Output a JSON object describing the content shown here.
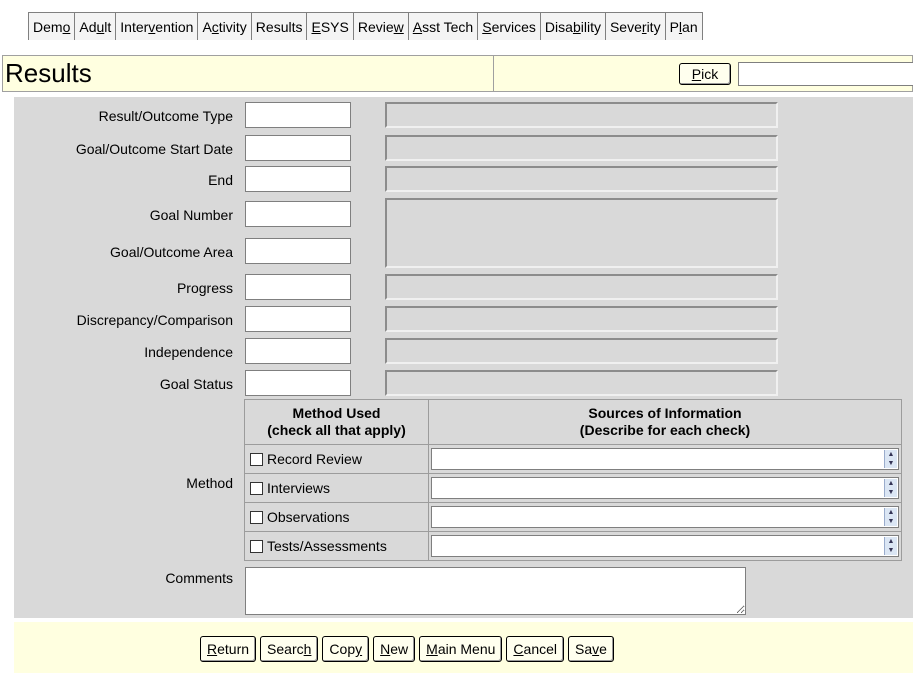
{
  "tabs": [
    {
      "pre": "Dem",
      "key": "o",
      "post": ""
    },
    {
      "pre": "Ad",
      "key": "u",
      "post": "lt"
    },
    {
      "pre": "Inter",
      "key": "v",
      "post": "ention"
    },
    {
      "pre": "A",
      "key": "c",
      "post": "tivity"
    },
    {
      "pre": "Results",
      "key": "",
      "post": ""
    },
    {
      "pre": "",
      "key": "E",
      "post": "SYS"
    },
    {
      "pre": "Revie",
      "key": "w",
      "post": ""
    },
    {
      "pre": "",
      "key": "A",
      "post": "sst Tech"
    },
    {
      "pre": "",
      "key": "S",
      "post": "ervices"
    },
    {
      "pre": "Disa",
      "key": "b",
      "post": "ility"
    },
    {
      "pre": "Seve",
      "key": "r",
      "post": "ity"
    },
    {
      "pre": "P",
      "key": "l",
      "post": "an"
    }
  ],
  "header": {
    "title": "Results",
    "pick_key": "P",
    "pick_rest": "ick",
    "pick_value": ""
  },
  "fields": {
    "result_type": {
      "label": "Result/Outcome Type",
      "value": "",
      "desc": ""
    },
    "start_date": {
      "label": "Goal/Outcome Start Date",
      "value": "",
      "desc": ""
    },
    "end": {
      "label": "End",
      "value": "",
      "desc": ""
    },
    "goal_number": {
      "label": "Goal Number",
      "value": ""
    },
    "goal_area": {
      "label": "Goal/Outcome Area",
      "value": "",
      "desc": ""
    },
    "progress": {
      "label": "Progress",
      "value": "",
      "desc": ""
    },
    "discrepancy": {
      "label": "Discrepancy/Comparison",
      "value": "",
      "desc": ""
    },
    "independence": {
      "label": "Independence",
      "value": "",
      "desc": ""
    },
    "goal_status": {
      "label": "Goal Status",
      "value": "",
      "desc": ""
    }
  },
  "method": {
    "label": "Method",
    "col1_line1": "Method Used",
    "col1_line2": "(check all that apply)",
    "col2_line1": "Sources of Information",
    "col2_line2": "(Describe for each check)",
    "rows": [
      {
        "label": "Record Review",
        "checked": false,
        "source": ""
      },
      {
        "label": "Interviews",
        "checked": false,
        "source": ""
      },
      {
        "label": "Observations",
        "checked": false,
        "source": ""
      },
      {
        "label": "Tests/Assessments",
        "checked": false,
        "source": ""
      }
    ]
  },
  "comments": {
    "label": "Comments",
    "value": ""
  },
  "footer": {
    "buttons": [
      {
        "pre": "",
        "key": "R",
        "post": "eturn"
      },
      {
        "pre": "Searc",
        "key": "h",
        "post": ""
      },
      {
        "pre": "Cop",
        "key": "y",
        "post": ""
      },
      {
        "pre": "",
        "key": "N",
        "post": "ew"
      },
      {
        "pre": "",
        "key": "M",
        "post": "ain Menu"
      },
      {
        "pre": "",
        "key": "C",
        "post": "ancel"
      },
      {
        "pre": "Sa",
        "key": "v",
        "post": "e"
      }
    ]
  }
}
